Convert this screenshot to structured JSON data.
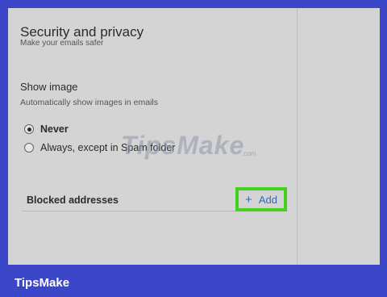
{
  "section": {
    "title": "Security and privacy",
    "subtitle": "Make your emails safer"
  },
  "show_image": {
    "title": "Show image",
    "subtitle": "Automatically show images in emails",
    "options": [
      {
        "label": "Never",
        "selected": true
      },
      {
        "label": "Always, except in Spam folder",
        "selected": false
      }
    ]
  },
  "blocked": {
    "label": "Blocked addresses",
    "add_label": "Add",
    "add_icon": "plus-icon"
  },
  "watermark": {
    "text": "TipsMake",
    "suffix": ".com"
  },
  "brand": "TipsMake",
  "colors": {
    "highlight": "#45d21c",
    "link": "#2a6db5",
    "frame": "#3b46c8"
  }
}
